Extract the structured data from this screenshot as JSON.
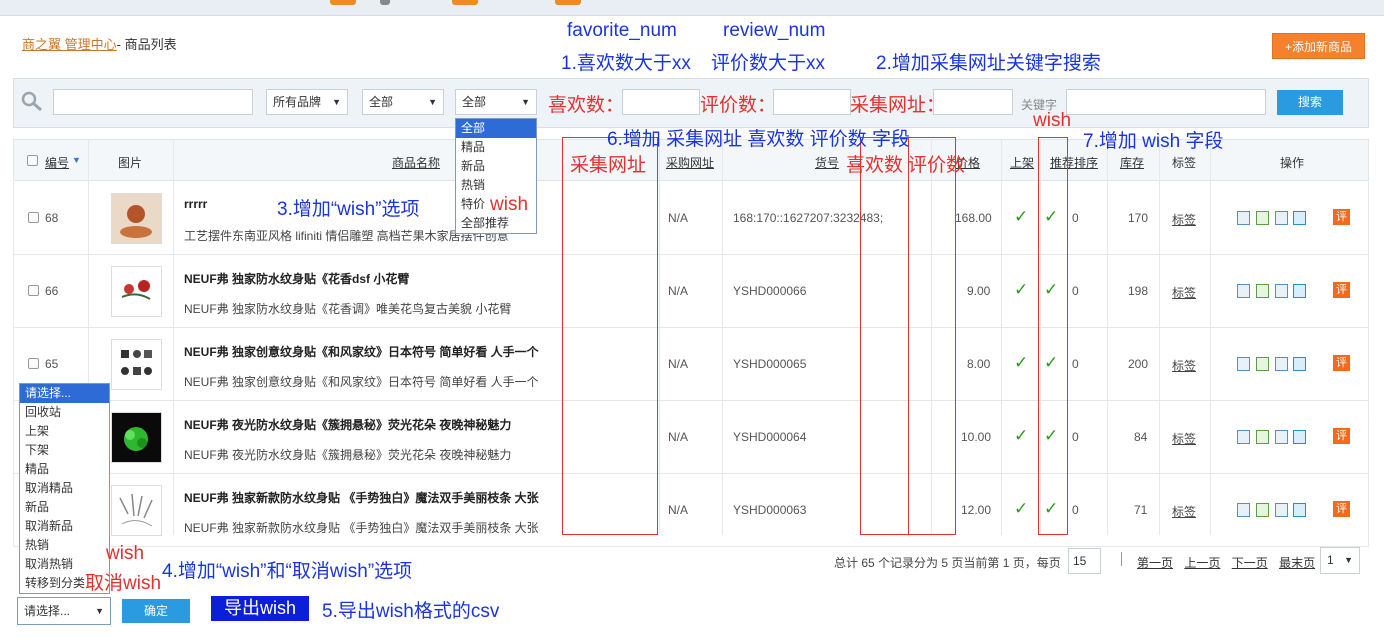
{
  "breadcrumb": {
    "link": "商之翼 管理中心",
    "sep": "- ",
    "current": "商品列表"
  },
  "add_button": "添加新商品",
  "filter": {
    "brand": "所有品牌",
    "cat": "全部",
    "type": "全部",
    "keyword_label": "关键字",
    "search": "搜索"
  },
  "type_options": [
    "全部",
    "精品",
    "新品",
    "热销",
    "特价",
    "全部推荐"
  ],
  "annot": {
    "fav_num": "favorite_num",
    "rev_num": "review_num",
    "a1": "1.喜欢数大于xx",
    "a1b": "评价数大于xx",
    "a2": "2.增加采集网址关键字搜索",
    "fav_lbl": "喜欢数：",
    "rev_lbl": "评价数：",
    "url_lbl": "采集网址：",
    "a6": "6.增加 采集网址 喜欢数 评价数 字段",
    "wish_top": "wish",
    "a7": "7.增加 wish 字段",
    "col_url": "采集网址",
    "col_fav": "喜欢数",
    "col_rev": "评价数",
    "a3": "3.增加“wish”选项",
    "wish3": "wish",
    "wish4": "wish",
    "cancel_wish": "取消wish",
    "a4": "4.增加“wish”和“取消wish”选项",
    "export": "导出wish",
    "a5": "5.导出wish格式的csv"
  },
  "headers": {
    "id": "编号",
    "img": "图片",
    "name": "商品名称",
    "purchase": "采购网址",
    "sku": "货号",
    "price": "价格",
    "onsale": "上架",
    "rec": "推荐排序",
    "stock": "库存",
    "tag": "标签",
    "ops": "操作"
  },
  "rows": [
    {
      "id": "68",
      "name": "rrrrr",
      "desc": "工艺摆件东南亚风格 lifiniti 情侣雕塑 高档芒果木家居摆件创意",
      "purchase": "N/A",
      "sku": "168:170::1627207:3232483;",
      "price": "168.00",
      "rec": "0",
      "stock": "170",
      "tag": "标签"
    },
    {
      "id": "66",
      "name": "NEUF弗 独家防水纹身贴《花香dsf 小花臂",
      "desc": "NEUF弗 独家防水纹身贴《花香调》唯美花鸟复古美貌 小花臂",
      "purchase": "N/A",
      "sku": "YSHD000066",
      "price": "9.00",
      "rec": "0",
      "stock": "198",
      "tag": "标签"
    },
    {
      "id": "65",
      "name": "NEUF弗 独家创意纹身贴《和风家纹》日本符号 简单好看 人手一个",
      "desc": "NEUF弗 独家创意纹身贴《和风家纹》日本符号 简单好看 人手一个",
      "purchase": "N/A",
      "sku": "YSHD000065",
      "price": "8.00",
      "rec": "0",
      "stock": "200",
      "tag": "标签"
    },
    {
      "id": "64",
      "name": "NEUF弗 夜光防水纹身贴《簇拥悬秘》荧光花朵 夜晚神秘魅力",
      "desc": "NEUF弗 夜光防水纹身贴《簇拥悬秘》荧光花朵 夜晚神秘魅力",
      "purchase": "N/A",
      "sku": "YSHD000064",
      "price": "10.00",
      "rec": "0",
      "stock": "84",
      "tag": "标签"
    },
    {
      "id": "63",
      "name": "NEUF弗 独家新款防水纹身贴 《手势独白》魔法双手美丽枝条 大张",
      "desc": "NEUF弗 独家新款防水纹身贴 《手势独白》魔法双手美丽枝条 大张",
      "purchase": "N/A",
      "sku": "YSHD000063",
      "price": "12.00",
      "rec": "0",
      "stock": "71",
      "tag": "标签"
    }
  ],
  "ping": "评",
  "batch_options": [
    "请选择...",
    "回收站",
    "上架",
    "下架",
    "精品",
    "取消精品",
    "新品",
    "取消新品",
    "热销",
    "取消热销",
    "转移到分类"
  ],
  "batch_select": "请选择...",
  "confirm": "确定",
  "pager": {
    "summary": "总计 65 个记录分为 5 页当前第 1 页，每页",
    "per_page": "15",
    "first": "第一页",
    "prev": "上一页",
    "next": "下一页",
    "last": "最末页",
    "page": "1"
  }
}
